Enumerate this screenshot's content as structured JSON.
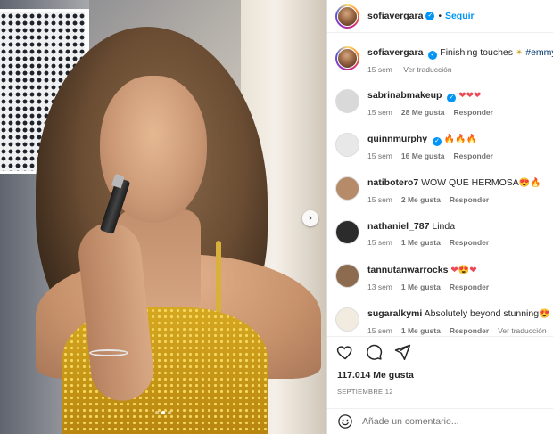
{
  "post": {
    "author": "sofiavergara",
    "follow_label": "Seguir",
    "separator": "•",
    "caption_text": "Finishing touches",
    "caption_hashtag": "#emmys",
    "caption_age": "15 sem",
    "see_translation": "Ver traducción",
    "likes": "117.014 Me gusta",
    "date": "SEPTIEMBRE 12",
    "comment_placeholder": "Añade un comentario...",
    "carousel": {
      "slide_count": 3,
      "active_index": 1
    }
  },
  "comments": [
    {
      "user": "sabrinabmakeup",
      "verified": true,
      "text": "",
      "emoji": "❤❤❤",
      "emoji_class": "heart",
      "age": "15 sem",
      "likes": "28 Me gusta",
      "reply": "Responder",
      "avatar_color": "#d9d9d9"
    },
    {
      "user": "quinnmurphy",
      "verified": true,
      "text": "",
      "emoji": "🔥🔥🔥",
      "emoji_class": "fire",
      "age": "15 sem",
      "likes": "16 Me gusta",
      "reply": "Responder",
      "avatar_color": "#e8e8e8"
    },
    {
      "user": "natibotero7",
      "verified": false,
      "text": "WOW QUE HERMOSA",
      "emoji": "😍🔥",
      "emoji_class": "fire",
      "age": "15 sem",
      "likes": "2 Me gusta",
      "reply": "Responder",
      "avatar_color": "#b58b6a"
    },
    {
      "user": "nathaniel_787",
      "verified": false,
      "text": "Linda",
      "emoji": "",
      "emoji_class": "",
      "age": "15 sem",
      "likes": "1 Me gusta",
      "reply": "Responder",
      "avatar_color": "#2b2b2b"
    },
    {
      "user": "tannutanwarrocks",
      "verified": false,
      "text": "",
      "emoji": "❤😍❤",
      "emoji_class": "heart",
      "age": "13 sem",
      "likes": "1 Me gusta",
      "reply": "Responder",
      "avatar_color": "#8d6b4f"
    },
    {
      "user": "sugaralkymi",
      "verified": false,
      "text": "Absolutely beyond stunning",
      "emoji": "😍",
      "emoji_class": "",
      "age": "15 sem",
      "likes": "1 Me gusta",
      "reply": "Responder",
      "see_translation": "Ver traducción",
      "avatar_color": "#f2ece0"
    }
  ],
  "icons": {
    "verified": "✓",
    "next": "›",
    "sparkle": "✴"
  }
}
